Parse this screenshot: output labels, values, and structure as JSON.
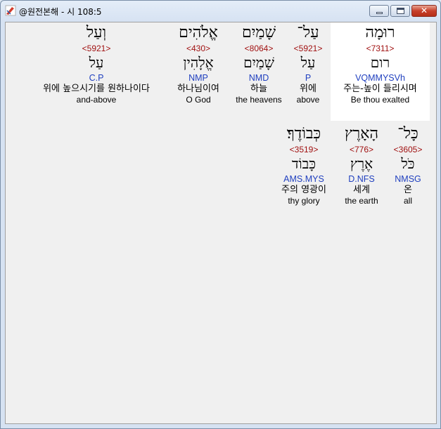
{
  "window": {
    "title": "@원전본해 - 시 108:5"
  },
  "words": [
    {
      "hebrew": "רוּמָה",
      "strong": "<7311>",
      "lemma": "רום",
      "parse": "VQMMYSVh",
      "korean": "주는-높이 들리시며",
      "english": "Be thou exalted",
      "selected": true
    },
    {
      "hebrew": "עַל־",
      "strong": "<5921>",
      "lemma": "עַל",
      "parse": "P",
      "korean": "위에",
      "english": "above",
      "selected": false
    },
    {
      "hebrew": "שָׁמַיִם",
      "strong": "<8064>",
      "lemma": "שָׁמַיִם",
      "parse": "NMD",
      "korean": "하늘",
      "english": "the heavens",
      "selected": false
    },
    {
      "hebrew": "אֱלֹהִים",
      "strong": "<430>",
      "lemma": "אֱלָהִין",
      "parse": "NMP",
      "korean": "하나님이여",
      "english": "O God",
      "selected": false
    },
    {
      "hebrew": "וְעַל",
      "strong": "<5921>",
      "lemma": "עַל",
      "parse": "C.P",
      "korean": "위에 높으시기를 원하나이다",
      "english": "and-above",
      "selected": false
    },
    {
      "hebrew": "כָּל־",
      "strong": "<3605>",
      "lemma": "כֹּל",
      "parse": "NMSG",
      "korean": "온",
      "english": "all",
      "selected": false
    },
    {
      "hebrew": "הָאָרֶץ",
      "strong": "<776>",
      "lemma": "אֶרֶץ",
      "parse": "D.NFS",
      "korean": "세계",
      "english": "the earth",
      "selected": false
    },
    {
      "hebrew": "כְּבוֹדֶךָ׃",
      "strong": "<3519>",
      "lemma": "כָּבוֹד",
      "parse": "AMS.MYS",
      "korean": "주의 영광이",
      "english": "thy glory",
      "selected": false
    }
  ]
}
